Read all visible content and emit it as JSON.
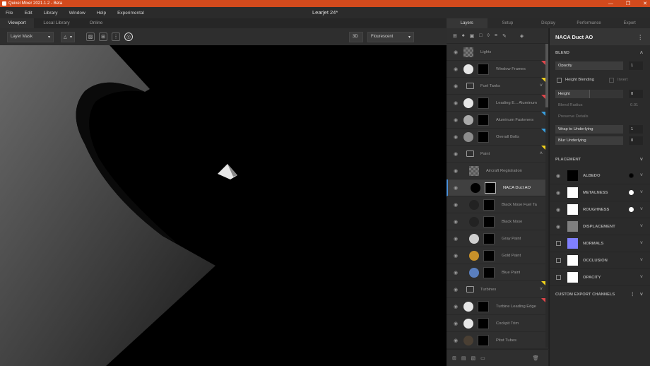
{
  "titlebar": {
    "app_title": "Quixel Mixer 2021.1.2 - Beta",
    "minimize_icon": "—",
    "restore_icon": "❐",
    "close_icon": "✕"
  },
  "menu": [
    "File",
    "Edit",
    "Library",
    "Window",
    "Help",
    "Experimental"
  ],
  "document_title": "Learjet 24*",
  "view_tabs": [
    "Viewport",
    "Local Library",
    "Online"
  ],
  "toolbar": {
    "layer_mask": "Layer Mask",
    "view_mode": "3D",
    "lighting": "Flourescent"
  },
  "right_tabs": [
    "Layers",
    "Setup",
    "Display",
    "Performance",
    "Export"
  ],
  "layers": [
    {
      "name": "Lights",
      "kind": "checker"
    },
    {
      "name": "Window Frames",
      "kind": "white",
      "tag": "#e0454a"
    },
    {
      "name": "Fuel Tanks",
      "kind": "folder",
      "tag": "#f2d21c"
    },
    {
      "name": "Leading E... Aluminum",
      "kind": "white",
      "tag": "#e0454a"
    },
    {
      "name": "Aluminum Fasteners",
      "kind": "grey",
      "tag": "#3aa0e0"
    },
    {
      "name": "Overall Bolts",
      "kind": "grey2",
      "tag": "#3aa0e0"
    },
    {
      "name": "Paint",
      "kind": "folder-open",
      "tag": "#f2d21c"
    },
    {
      "name": "Aircraft Registration",
      "kind": "checker-sub"
    },
    {
      "name": "NACA Duct AO",
      "kind": "black-sub",
      "selected": true
    },
    {
      "name": "Black Nose Fuel Ta",
      "kind": "dark-sub"
    },
    {
      "name": "Black Nose",
      "kind": "dark-sub"
    },
    {
      "name": "Gray Paint",
      "kind": "lightgrey-sub"
    },
    {
      "name": "Gold Paint",
      "kind": "gold-sub"
    },
    {
      "name": "Blue Paint",
      "kind": "blue-sub"
    },
    {
      "name": "Turbines",
      "kind": "folder",
      "tag": "#f2d21c"
    },
    {
      "name": "Turbine Leading Edge",
      "kind": "white",
      "tag": "#e0454a"
    },
    {
      "name": "Cockpit Trim",
      "kind": "white"
    },
    {
      "name": "Pitot Tubes",
      "kind": "brown"
    }
  ],
  "props": {
    "layer_name": "NACA Duct AO",
    "blend_section": "BLEND",
    "opacity_label": "Opacity",
    "opacity_value": "1",
    "height_blending_label": "Height Blending",
    "invert_label": "Invert",
    "height_label": "Height",
    "height_value": "0",
    "blend_radius_label": "Blend Radius",
    "blend_radius_value": "0.01",
    "preserve_details_label": "Preserve Details",
    "wrap_label": "Wrap to Underlying",
    "wrap_value": "1",
    "blur_label": "Blur Underlying",
    "blur_value": "0",
    "placement_section": "PLACEMENT",
    "channels": [
      {
        "name": "ALBEDO",
        "color": "#000000",
        "dot": "#000000",
        "visible": true
      },
      {
        "name": "METALNESS",
        "color": "#ffffff",
        "dot": "#ffffff",
        "visible": true
      },
      {
        "name": "ROUGHNESS",
        "color": "#ffffff",
        "dot": "#ffffff",
        "visible": true
      },
      {
        "name": "DISPLACEMENT",
        "color": "#7f7f7f",
        "dot": "",
        "visible": true
      },
      {
        "name": "NORMALS",
        "color": "#8080ff",
        "dot": "",
        "visible": false
      },
      {
        "name": "OCCLUSION",
        "color": "#ffffff",
        "dot": "",
        "visible": false
      },
      {
        "name": "OPACITY",
        "color": "#ffffff",
        "dot": "",
        "visible": false
      }
    ],
    "custom_export_section": "CUSTOM EXPORT CHANNELS"
  }
}
